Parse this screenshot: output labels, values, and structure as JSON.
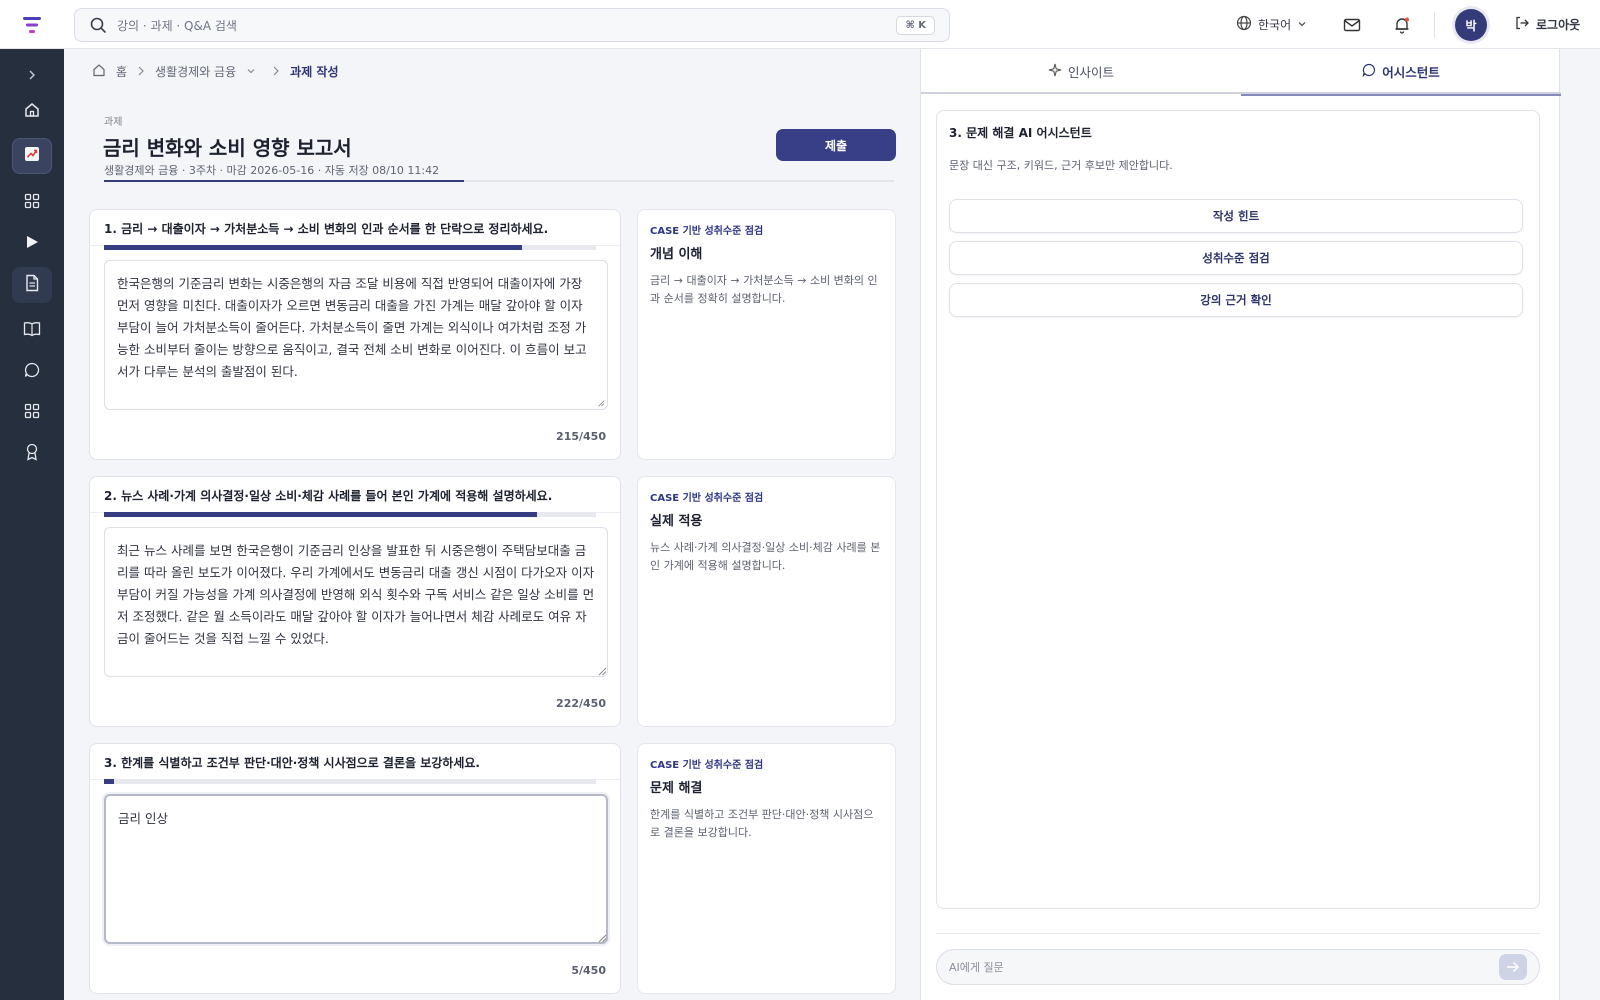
{
  "search": {
    "placeholder": "강의 · 과제 · Q&A 검색",
    "shortcut": "⌘ K"
  },
  "header": {
    "language": "한국어",
    "avatar_initial": "박",
    "logout": "로그아웃"
  },
  "breadcrumb": {
    "home": "홈",
    "course": "생활경제와 금융",
    "current": "과제 작성"
  },
  "assignment": {
    "eyebrow": "과제",
    "title": "금리 변화와 소비 영향 보고서",
    "meta": "생활경제와 금융 · 3주차 · 마감 2026-05-16 · 자동 저장 08/10 11:42",
    "submit_label": "제출"
  },
  "questions": [
    {
      "title": "1. 금리 → 대출이자 → 가처분소득 → 소비 변화의 인과 순서를 한 단락으로 정리하세요.",
      "progress": 0.85,
      "answer": "한국은행의 기준금리 변화는 시중은행의 자금 조달 비용에 직접 반영되어 대출이자에 가장 먼저 영향을 미친다. 대출이자가 오르면 변동금리 대출을 가진 가계는 매달 갚아야 할 이자 부담이 늘어 가처분소득이 줄어든다. 가처분소득이 줄면 가계는 외식이나 여가처럼 조정 가능한 소비부터 줄이는 방향으로 움직이고, 결국 전체 소비 변화로 이어진다. 이 흐름이 보고서가 다루는 분석의 출발점이 된다.",
      "count": "215/450"
    },
    {
      "title": "2. 뉴스 사례·가계 의사결정·일상 소비·체감 사례를 들어 본인 가계에 적용해 설명하세요.",
      "progress": 0.88,
      "answer": "최근 뉴스 사례를 보면 한국은행이 기준금리 인상을 발표한 뒤 시중은행이 주택담보대출 금리를 따라 올린 보도가 이어졌다. 우리 가계에서도 변동금리 대출 갱신 시점이 다가오자 이자 부담이 커질 가능성을 가계 의사결정에 반영해 외식 횟수와 구독 서비스 같은 일상 소비를 먼저 조정했다. 같은 월 소득이라도 매달 갚아야 할 이자가 늘어나면서 체감 사례로도 여유 자금이 줄어드는 것을 직접 느낄 수 있었다.",
      "count": "222/450"
    },
    {
      "title": "3. 한계를 식별하고 조건부 판단·대안·정책 시사점으로 결론을 보강하세요.",
      "progress": 0.02,
      "answer": "금리 인상",
      "count": "5/450"
    }
  ],
  "criteria": [
    {
      "kicker": "CASE 기반 성취수준 점검",
      "title": "개념 이해",
      "desc": "금리 → 대출이자 → 가처분소득 → 소비 변화의 인과 순서를 정확히 설명합니다."
    },
    {
      "kicker": "CASE 기반 성취수준 점검",
      "title": "실제 적용",
      "desc": "뉴스 사례·가계 의사결정·일상 소비·체감 사례를 본인 가계에 적용해 설명합니다."
    },
    {
      "kicker": "CASE 기반 성취수준 점검",
      "title": "문제 해결",
      "desc": "한계를 식별하고 조건부 판단·대안·정책 시사점으로 결론을 보강합니다."
    }
  ],
  "panel": {
    "tabs": [
      {
        "label": "인사이트"
      },
      {
        "label": "어시스턴트"
      }
    ],
    "assistant_title": "3. 문제 해결 AI 어시스턴트",
    "assistant_desc": "문장 대신 구조, 키워드, 근거 후보만 제안합니다.",
    "actions": [
      {
        "label": "작성 힌트"
      },
      {
        "label": "성취수준 점검"
      },
      {
        "label": "강의 근거 확인"
      }
    ],
    "ask_placeholder": "AI에게 질문"
  },
  "colors": {
    "primary": "#383f86",
    "sidebar": "#262f3e",
    "accent_logo": "#7b3fd1"
  },
  "icons": [
    "menu-logo-icon",
    "search-icon",
    "globe-icon",
    "mail-icon",
    "bell-icon",
    "logout-icon",
    "home-icon",
    "chart-icon",
    "grid-icon",
    "play-icon",
    "document-icon",
    "book-icon",
    "chat-icon",
    "award-icon",
    "sparkle-icon",
    "send-icon"
  ]
}
